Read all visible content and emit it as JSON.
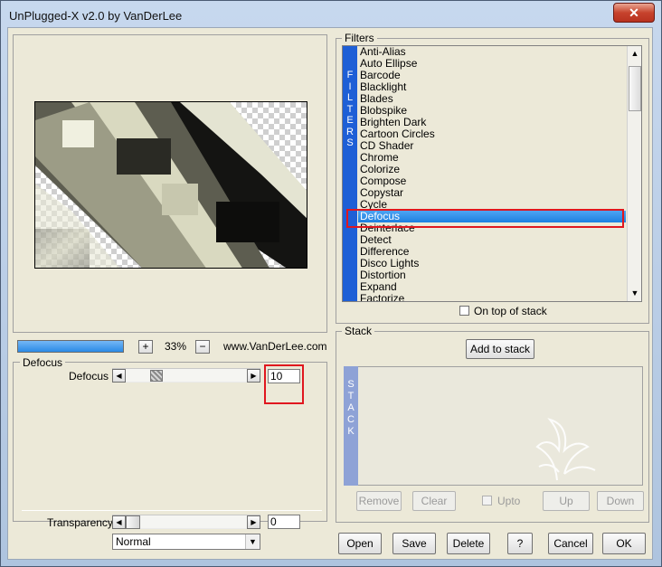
{
  "window": {
    "title": "UnPlugged-X v2.0 by VanDerLee",
    "close_label": "✕"
  },
  "preview": {
    "zoom_plus": "+",
    "zoom_level": "33%",
    "zoom_minus": "−",
    "website": "www.VanDerLee.com",
    "progress": 1.0
  },
  "params": {
    "group_label": "Defocus",
    "defocus_label": "Defocus",
    "defocus_value": "10",
    "transparency_label": "Transparency",
    "transparency_value": "0",
    "blend_mode": "Normal"
  },
  "filters": {
    "group_label": "Filters",
    "sidebar_letters": [
      "F",
      "I",
      "L",
      "T",
      "E",
      "R",
      "S"
    ],
    "items": [
      "Anti-Alias",
      "Auto Ellipse",
      "Barcode",
      "Blacklight",
      "Blades",
      "Blobspike",
      "Brighten Dark",
      "Cartoon Circles",
      "CD Shader",
      "Chrome",
      "Colorize",
      "Compose",
      "Copystar",
      "Cycle",
      "Defocus",
      "Deinterlace",
      "Detect",
      "Difference",
      "Disco Lights",
      "Distortion",
      "Expand",
      "Factorize"
    ],
    "selected": "Defocus",
    "on_top_label": "On top of stack"
  },
  "stack": {
    "group_label": "Stack",
    "add_label": "Add to stack",
    "sidebar_letters": [
      "S",
      "T",
      "A",
      "C",
      "K"
    ],
    "remove_label": "Remove",
    "clear_label": "Clear",
    "upto_label": "Upto",
    "up_label": "Up",
    "down_label": "Down"
  },
  "buttons": {
    "open": "Open",
    "save": "Save",
    "delete": "Delete",
    "help": "?",
    "cancel": "Cancel",
    "ok": "OK"
  },
  "colors": {
    "selection": "#1d80e0",
    "filter_bar": "#1e5fd6",
    "stack_bar": "#8ea2d6",
    "highlight_box": "#e0171f"
  }
}
